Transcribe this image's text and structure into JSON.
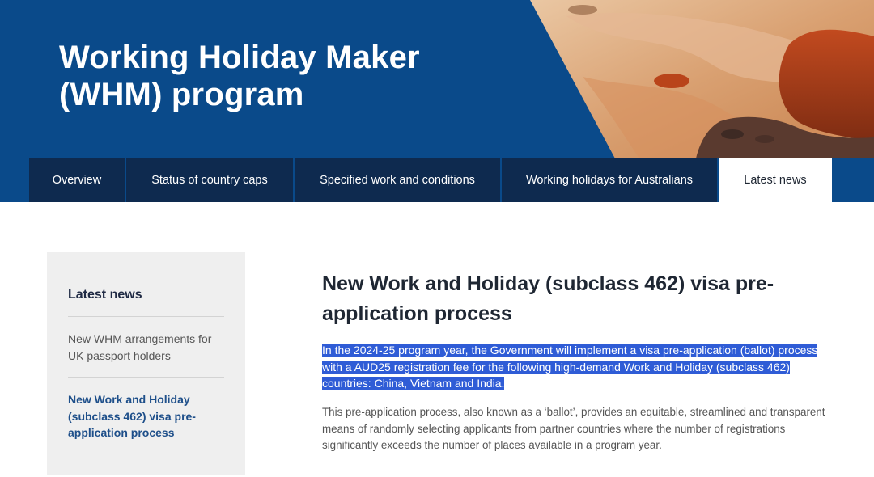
{
  "hero": {
    "title_line1": "Working Holiday Maker",
    "title_line2": "(WHM) program",
    "background_color": "#0a4a8a"
  },
  "tabs": [
    {
      "label": "Overview",
      "active": false
    },
    {
      "label": "Status of country caps",
      "active": false
    },
    {
      "label": "Specified work and conditions",
      "active": false
    },
    {
      "label": "Working holidays for Australians",
      "active": false
    },
    {
      "label": "Latest news",
      "active": true
    }
  ],
  "sidebar": {
    "title": "Latest news",
    "items": [
      {
        "label": "New WHM arrangements for UK passport holders",
        "active": false
      },
      {
        "label": "New Work and Holiday (subclass 462) visa pre-application process",
        "active": true
      }
    ]
  },
  "main": {
    "title": "New Work and Holiday (subclass 462) visa pre-application process",
    "highlighted_paragraph": "In the 2024-25 program year, the Government will implement a visa pre-application (ballot) process with a AUD25 registration fee for the following high-demand Work and Holiday (subclass 462) countries: China, Vietnam and India.",
    "paragraph": "This pre-application process, also known as a ‘ballot’, provides an equitable, streamlined and transparent means of randomly selecting applicants from partner countries where the number of registrations significantly exceeds the number of places available in a program year."
  },
  "colors": {
    "nav_dark": "#0e2a4f",
    "selection_highlight": "#2f5cd6",
    "link_active": "#1e4f8a"
  }
}
